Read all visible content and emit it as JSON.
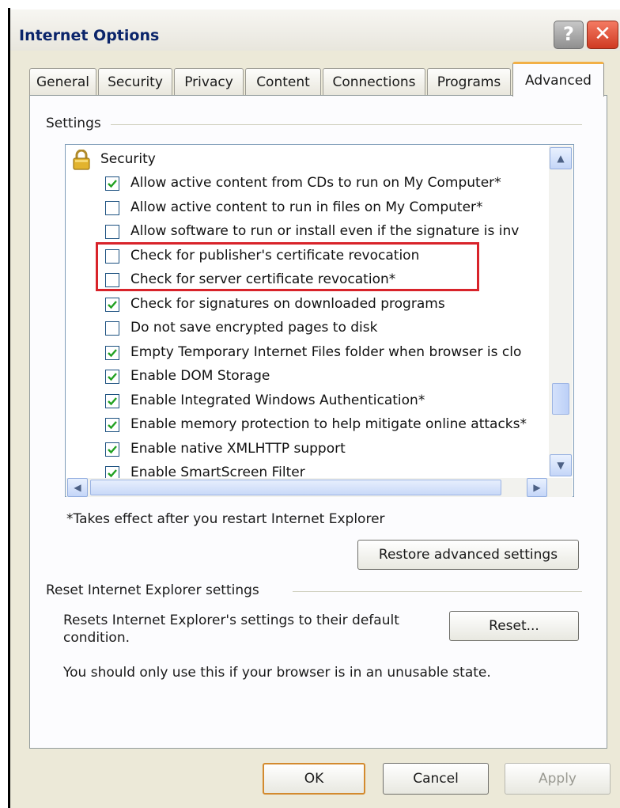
{
  "window": {
    "title": "Internet Options",
    "help_glyph": "?",
    "close_glyph": "✕"
  },
  "tabs": [
    {
      "label": "General",
      "active": false
    },
    {
      "label": "Security",
      "active": false
    },
    {
      "label": "Privacy",
      "active": false
    },
    {
      "label": "Content",
      "active": false
    },
    {
      "label": "Connections",
      "active": false
    },
    {
      "label": "Programs",
      "active": false
    },
    {
      "label": "Advanced",
      "active": true
    }
  ],
  "settings_group": {
    "label": "Settings",
    "category": {
      "label": "Security",
      "icon": "lock-icon"
    },
    "items": [
      {
        "label": "Allow active content from CDs to run on My Computer*",
        "checked": true
      },
      {
        "label": "Allow active content to run in files on My Computer*",
        "checked": false
      },
      {
        "label": "Allow software to run or install even if the signature is inv",
        "checked": false
      },
      {
        "label": "Check for publisher's certificate revocation",
        "checked": false
      },
      {
        "label": "Check for server certificate revocation*",
        "checked": false
      },
      {
        "label": "Check for signatures on downloaded programs",
        "checked": true
      },
      {
        "label": "Do not save encrypted pages to disk",
        "checked": false
      },
      {
        "label": "Empty Temporary Internet Files folder when browser is clo",
        "checked": true
      },
      {
        "label": "Enable DOM Storage",
        "checked": true
      },
      {
        "label": "Enable Integrated Windows Authentication*",
        "checked": true
      },
      {
        "label": "Enable memory protection to help mitigate online attacks*",
        "checked": true
      },
      {
        "label": "Enable native XMLHTTP support",
        "checked": true
      },
      {
        "label": "Enable SmartScreen Filter",
        "checked": true
      }
    ],
    "footnote": "*Takes effect after you restart Internet Explorer",
    "restore_button": "Restore advanced settings"
  },
  "reset_group": {
    "label": "Reset Internet Explorer settings",
    "description_line1": "Resets Internet Explorer's settings to their default",
    "description_line2": "condition.",
    "reset_button": "Reset...",
    "warning": "You should only use this if your browser is in an unusable state."
  },
  "footer": {
    "ok": "OK",
    "cancel": "Cancel",
    "apply": "Apply"
  },
  "colors": {
    "highlight": "#d8232a",
    "accent_tab": "#f2b046",
    "dialog_bg": "#ece9d8"
  }
}
